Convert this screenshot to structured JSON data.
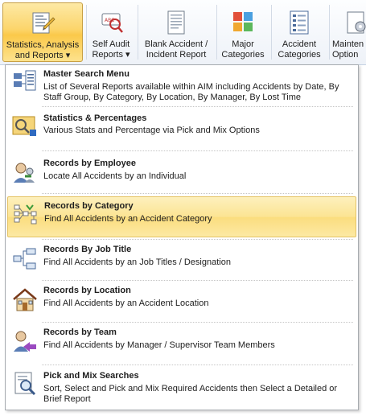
{
  "ribbon": {
    "buttons": [
      {
        "line1": "Statistics, Analysis",
        "line2": "and Reports ▾",
        "icon": "statistics-icon",
        "active": true
      },
      {
        "line1": "Self Audit",
        "line2": "Reports ▾",
        "icon": "self-audit-icon"
      },
      {
        "line1": "Blank Accident /",
        "line2": "Incident Report",
        "icon": "blank-report-icon"
      },
      {
        "line1": "Major",
        "line2": "Categories",
        "icon": "major-categories-icon"
      },
      {
        "line1": "Accident",
        "line2": "Categories",
        "icon": "accident-categories-icon"
      },
      {
        "line1": "Mainten",
        "line2": "Option",
        "icon": "maintenance-icon"
      }
    ]
  },
  "menu": {
    "items": [
      {
        "title": "Master Search Menu",
        "desc": "List of Several Reports available within AIM including Accidents by Date, By Staff Group, By Category, By Location, By Manager, By Lost Time",
        "icon": "master-search-icon"
      },
      {
        "title": "Statistics & Percentages",
        "desc": "Various Stats and Percentage via Pick and Mix Options",
        "icon": "statistics-percentages-icon"
      },
      {
        "title": "Records by Employee",
        "desc": "Locate All Accidents by an Individual",
        "icon": "employee-icon"
      },
      {
        "title": "Records by Category",
        "desc": "Find All Accidents by an Accident Category",
        "icon": "category-icon",
        "highlighted": true
      },
      {
        "title": "Records By Job Title",
        "desc": "Find All Accidents by an Job Titles / Designation",
        "icon": "job-title-icon"
      },
      {
        "title": "Records by Location",
        "desc": "Find All Accidents by an Accident Location",
        "icon": "location-house-icon"
      },
      {
        "title": "Records by Team",
        "desc": "Find All Accidents by Manager / Supervisor Team Members",
        "icon": "team-icon"
      },
      {
        "title": "Pick and Mix Searches",
        "desc": "Sort, Select and Pick and Mix Required Accidents then Select a Detailed or Brief Report",
        "icon": "pick-mix-search-icon"
      }
    ]
  },
  "colors": {
    "highlight": "#fce493",
    "active_button": "#fcd56b",
    "menu_border": "#a7abb0",
    "ribbon_bg": "#eef2f8"
  }
}
